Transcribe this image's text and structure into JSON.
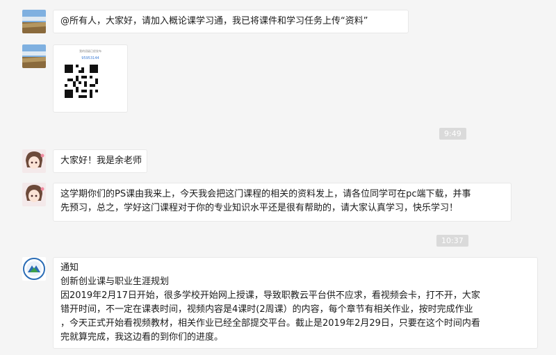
{
  "messages": [
    {
      "text": "@所有人，大家好，请加入概论课学习通，我已将课件和学习任务上传“资料”"
    },
    {
      "qr": {
        "caption": "我的班级已经发布",
        "code": "95953144"
      }
    },
    {
      "text": "大家好！我是余老师"
    },
    {
      "lines": [
        "这学期你们的PS课由我来上，今天我会把这门课程的相关的资料发上，请各位同学可在pc端下载，并事",
        "先预习，总之，学好这门课程对于你的专业知识水平还是很有帮助的，请大家认真学习，快乐学习！"
      ]
    },
    {
      "lines": [
        "通知",
        "创新创业课与职业生涯规划",
        "因2019年2月17日开始，很多学校开始网上授课，导致职教云平台供不应求，看视频会卡，打不开，大家",
        "错开时间，不一定在课表时间，视频内容是4课时(2周课）的内容，每个章节有相关作业，按时完成作业",
        "，今天正式开始看视频教材，相关作业已经全部提交平台。截止是2019年2月29日，只要在这个时间内看",
        "完就算完成，我这边看的到你们的进度。"
      ]
    }
  ],
  "timestamps": [
    "9:49",
    "10:37"
  ],
  "colors": {
    "background": "#f5f5f5",
    "bubble": "#ffffff",
    "timestamp_bg": "#dadada"
  }
}
